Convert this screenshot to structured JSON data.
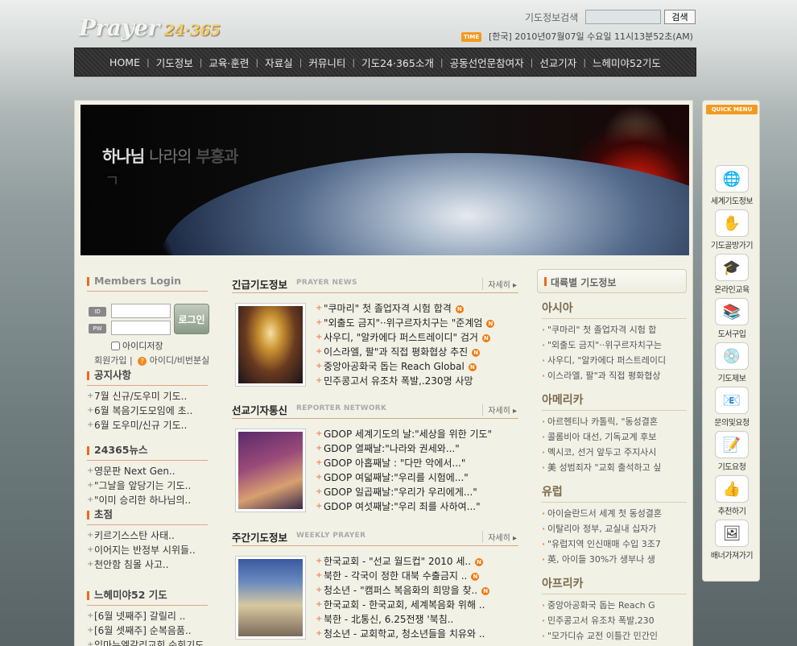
{
  "header": {
    "logo_text": "Prayer",
    "logo_num": "24·365",
    "search_label": "기도정보검색",
    "search_button": "검색",
    "time_badge": "TIME",
    "time_text": "[한국]  2010년07월07일 수요일  11시13분52초(AM)"
  },
  "nav": [
    "HOME",
    "기도정보",
    "교육·훈련",
    "자료실",
    "커뮤니티",
    "기도24·365소개",
    "공동선언문참여자",
    "선교기자",
    "느헤미야52기도"
  ],
  "banner": {
    "line1_a": "하나님",
    "line1_b": "나라의",
    "line1_c": "부흥과",
    "line2": "ㄱ"
  },
  "login": {
    "title": "Members Login",
    "id_label": "ID",
    "pw_label": "PW",
    "button": "로그인",
    "save_id": "아이디저장",
    "join": "회원가입",
    "sep": "|",
    "q": "?",
    "find": "아이디/비번분실"
  },
  "left_sections": [
    {
      "title": "공지사항",
      "items": [
        "7월 신규/도우미 기도..",
        "6월 복음기도모임에 초..",
        "6월 도우미/신규 기도.."
      ]
    },
    {
      "title": "24365뉴스",
      "items": [
        "영문판 Next Gen..",
        "\"그날을 앞당기는 기도..",
        "\"이미 승리한 하나님의.."
      ]
    },
    {
      "title": "초점",
      "items": [
        "키르기스스탄 사태..",
        "이어지는 반정부 시위들..",
        "천안함 침몰 사고.."
      ]
    },
    {
      "title": "느헤미야52 기도",
      "items": [
        "[6월 넷째주] 갈릴리 ..",
        "[6월 셋째주] 순복음품..",
        "임마누엘갈리교회 순회기도"
      ]
    }
  ],
  "center_sections": [
    {
      "title": "긴급기도정보",
      "eng": "PRAYER NEWS",
      "more": "자세히 ▸",
      "items": [
        {
          "text": "\"쿠마리\" 첫 졸업자격 시험 합격",
          "new": true
        },
        {
          "text": "\"외출도 금지\"··위구르자치구는 \"준계엄",
          "new": true
        },
        {
          "text": "사우디, \"알카에다 퍼스트레이디\" 검거",
          "new": true
        },
        {
          "text": "이스라엘, 팔\"과 직접 평화협상 추진",
          "new": true
        },
        {
          "text": "중앙아공화국 돕는 Reach Global",
          "new": true
        },
        {
          "text": "민주콩고서 유조차 폭발,.230명 사망",
          "new": false
        }
      ]
    },
    {
      "title": "선교기자통신",
      "eng": "REPORTER NETWORK",
      "more": "자세히 ▸",
      "items": [
        {
          "text": "GDOP 세계기도의 날:\"세상을 위한 기도\"",
          "new": false
        },
        {
          "text": "GDOP 열째날:\"나라와 권세와...\"",
          "new": false
        },
        {
          "text": "GDOP 아홉째날 : \"다만 악에서...\"",
          "new": false
        },
        {
          "text": "GDOP 여덟째날:\"우리를 시험에...\"",
          "new": false
        },
        {
          "text": "GDOP 일곱째날:\"우리가 우리에게...\"",
          "new": false
        },
        {
          "text": "GDOP 여섯째날:\"우리 죄를 사하여...\"",
          "new": false
        }
      ]
    },
    {
      "title": "주간기도정보",
      "eng": "WEEKLY PRAYER",
      "more": "자세히 ▸",
      "items": [
        {
          "text": "한국교회 - \"선교 월드컵\" 2010 세..",
          "new": true
        },
        {
          "text": "북한 - 각국이 정한 대북 수출금지 ..",
          "new": true
        },
        {
          "text": "청소년 - \"캠퍼스 복음화의 희망을 찾..",
          "new": true
        },
        {
          "text": "한국교회 - 한국교회, 세계복음화 위해 ..",
          "new": false
        },
        {
          "text": "북한 - 北통신, 6.25전쟁 '북침..",
          "new": false
        },
        {
          "text": "청소년 - 교회학교, 청소년들을 치유와 ..",
          "new": false
        }
      ]
    }
  ],
  "right": {
    "head": "대륙별 기도정보",
    "sections": [
      {
        "title": "아시아",
        "items": [
          "\"쿠마리\" 첫 졸업자격 시험 합",
          "\"외출도 금지\"··위구르자치구는",
          "사우디, \"알카에다 퍼스트레이디",
          "이스라엘, 팔\"과 직접 평화협상"
        ]
      },
      {
        "title": "아메리카",
        "items": [
          "아르헨티나 카톨릭, \"동성결혼",
          "콜롬비아 대선, 기독교계 후보",
          "멕시코, 선거 앞두고 주지사시",
          "美 성범죄자 \"교회 출석하고 싶"
        ]
      },
      {
        "title": "유럽",
        "items": [
          "아이슬란드서 세계 첫 동성결혼",
          "이탈리아 정부, 교실내 십자가",
          "\"유럽지역 인신매매 수입 3조7",
          "英, 아이들 30%가 생부나 생"
        ]
      },
      {
        "title": "아프리카",
        "items": [
          "중앙아공화국 돕는 Reach G",
          "민주콩고서 유조차 폭발,230",
          "\"모가디슈 교전 이틀간 민간인"
        ]
      }
    ]
  },
  "quick_menu": {
    "label": "QUICK MENU",
    "items": [
      {
        "label": "세계기도정보",
        "icon": "🌐",
        "icon_name": "world-prayer-icon"
      },
      {
        "label": "기도골방가기",
        "icon": "✋",
        "icon_name": "prayer-room-icon"
      },
      {
        "label": "온라인교육",
        "icon": "🎓",
        "icon_name": "online-education-icon"
      },
      {
        "label": "도서구입",
        "icon": "📚",
        "icon_name": "books-icon"
      },
      {
        "label": "기도제보",
        "icon": "💿",
        "icon_name": "prayer-report-icon"
      },
      {
        "label": "문의및요청",
        "icon": "📧",
        "icon_name": "inquiry-icon"
      },
      {
        "label": "기도요청",
        "icon": "📝",
        "icon_name": "prayer-request-icon"
      },
      {
        "label": "추천하기",
        "icon": "👍",
        "icon_name": "recommend-icon"
      },
      {
        "label": "배너가져가기",
        "icon": "🖼",
        "icon_name": "banner-icon"
      }
    ]
  },
  "colors": {
    "accent": "#ee6a20",
    "nav_bg": "#333333",
    "panel_bg": "#f2f1e6"
  }
}
